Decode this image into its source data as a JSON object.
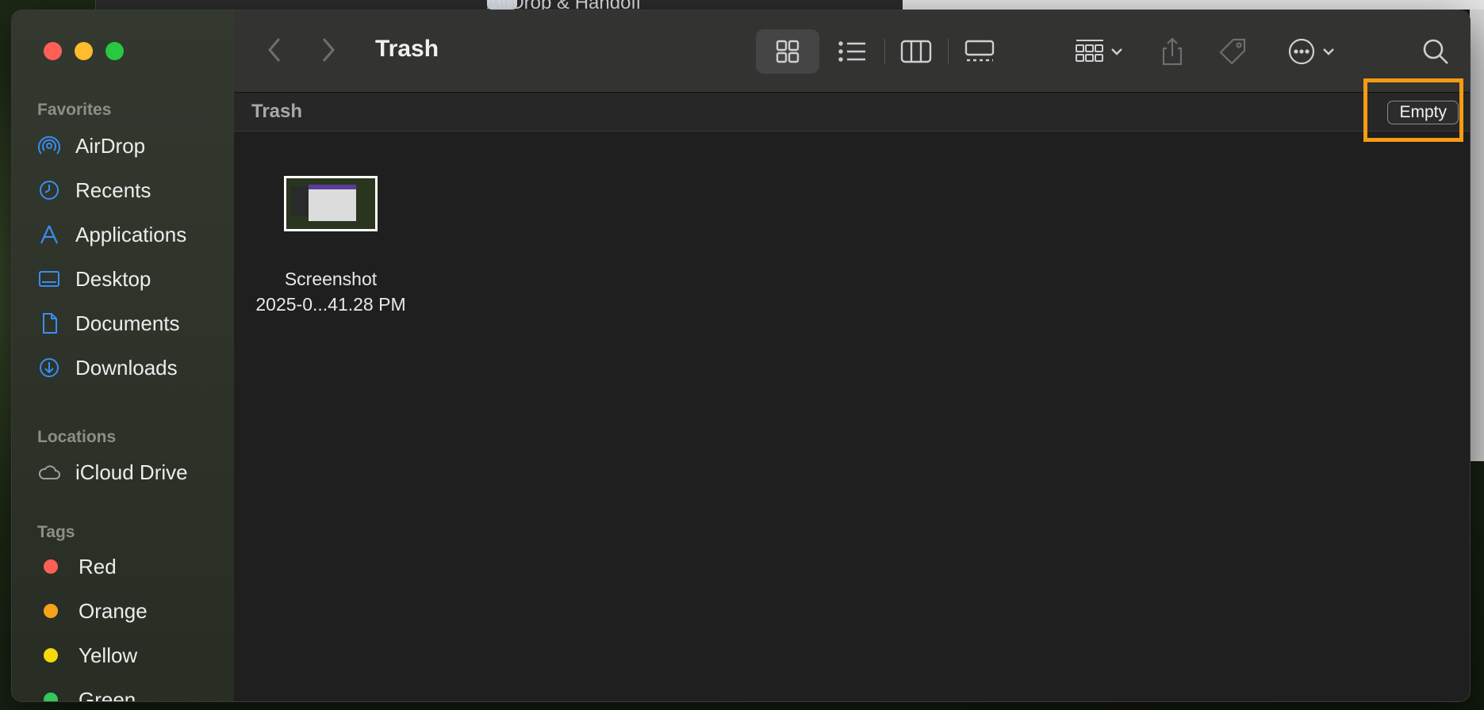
{
  "background": {
    "window_title": "AirDrop & Handoff"
  },
  "sidebar": {
    "favorites_heading": "Favorites",
    "favorites": [
      {
        "label": "AirDrop",
        "icon": "airdrop-icon"
      },
      {
        "label": "Recents",
        "icon": "clock-icon"
      },
      {
        "label": "Applications",
        "icon": "applications-icon"
      },
      {
        "label": "Desktop",
        "icon": "desktop-icon"
      },
      {
        "label": "Documents",
        "icon": "document-icon"
      },
      {
        "label": "Downloads",
        "icon": "download-icon"
      }
    ],
    "locations_heading": "Locations",
    "locations": [
      {
        "label": "iCloud Drive",
        "icon": "cloud-icon"
      }
    ],
    "tags_heading": "Tags",
    "tags": [
      {
        "label": "Red",
        "color": "#ff5f57"
      },
      {
        "label": "Orange",
        "color": "#f7a21b"
      },
      {
        "label": "Yellow",
        "color": "#f5d90a"
      },
      {
        "label": "Green",
        "color": "#34c759"
      }
    ]
  },
  "toolbar": {
    "title": "Trash"
  },
  "pathbar": {
    "label": "Trash",
    "empty_button": "Empty"
  },
  "files": [
    {
      "name_line1": "Screenshot",
      "name_line2": "2025-0...41.28 PM"
    }
  ],
  "colors": {
    "accent_icon": "#3b8cf0",
    "highlight": "#f39c12"
  }
}
